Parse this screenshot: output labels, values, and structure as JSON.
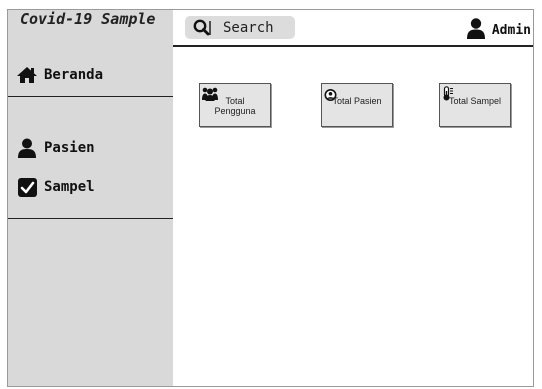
{
  "app": {
    "title": "Covid-19 Sample"
  },
  "sidebar": {
    "items": [
      {
        "label": "Beranda",
        "icon": "home-icon"
      },
      {
        "label": "Pasien",
        "icon": "user-icon"
      },
      {
        "label": "Sampel",
        "icon": "checkbox-icon"
      }
    ]
  },
  "header": {
    "search_label": "Search",
    "user_label": "Admin"
  },
  "cards": [
    {
      "label_line1": "Total",
      "label_line2": "Pengguna",
      "icon": "users-icon"
    },
    {
      "label": "Total Pasien",
      "icon": "user-circle-icon"
    },
    {
      "label": "Total Sampel",
      "icon": "thermometer-icon"
    }
  ]
}
